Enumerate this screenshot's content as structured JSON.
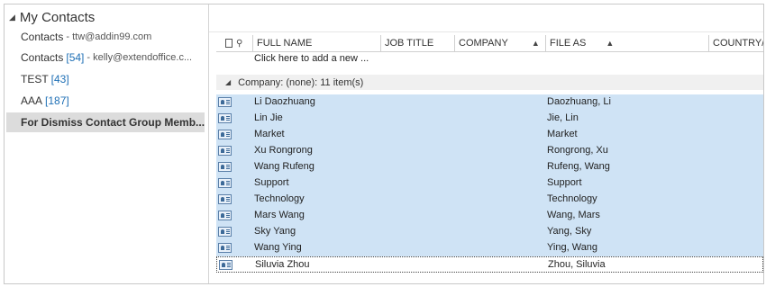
{
  "sidebar": {
    "header": "My Contacts",
    "items": [
      {
        "label": "Contacts",
        "count": "",
        "sub": "- ttw@addin99.com"
      },
      {
        "label": "Contacts",
        "count": "[54]",
        "sub": "- kelly@extendoffice.c..."
      },
      {
        "label": "TEST",
        "count": "[43]",
        "sub": ""
      },
      {
        "label": "AAA",
        "count": "[187]",
        "sub": ""
      },
      {
        "label": "For Dismiss Contact Group Memb...",
        "count": "",
        "sub": ""
      }
    ]
  },
  "columns": {
    "full_name": "FULL NAME",
    "job_title": "JOB TITLE",
    "company": "COMPANY",
    "file_as": "FILE AS",
    "country": "COUNTRY/R"
  },
  "add_row": "Click here to add a new ...",
  "group_label": "Company: (none): 11 item(s)",
  "rows": [
    {
      "name": "Li Daozhuang",
      "file_as": "Daozhuang, Li"
    },
    {
      "name": "Lin Jie",
      "file_as": "Jie, Lin"
    },
    {
      "name": "Market",
      "file_as": "Market"
    },
    {
      "name": "Xu Rongrong",
      "file_as": "Rongrong, Xu"
    },
    {
      "name": "Wang Rufeng",
      "file_as": "Rufeng, Wang"
    },
    {
      "name": "Support",
      "file_as": "Support"
    },
    {
      "name": "Technology",
      "file_as": "Technology"
    },
    {
      "name": "Mars Wang",
      "file_as": "Wang, Mars"
    },
    {
      "name": "Sky Yang",
      "file_as": "Yang, Sky"
    },
    {
      "name": "Wang Ying",
      "file_as": "Ying, Wang"
    },
    {
      "name": "Siluvia Zhou",
      "file_as": "Zhou, Siluvia"
    }
  ]
}
